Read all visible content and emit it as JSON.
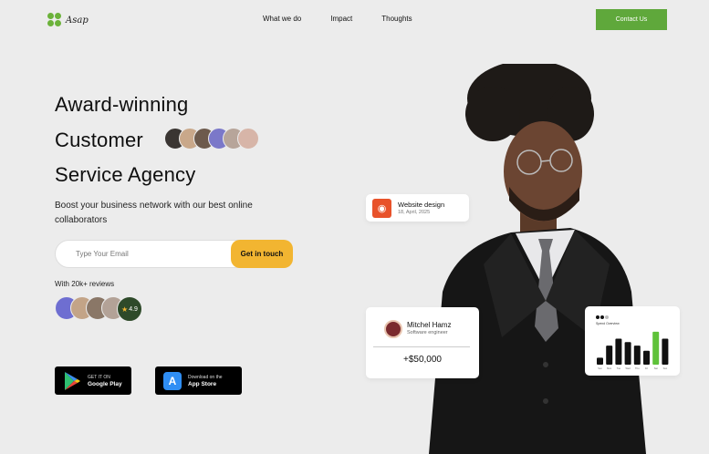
{
  "header": {
    "logo_text": "Asap",
    "nav": [
      "What we do",
      "Impact",
      "Thoughts"
    ],
    "contact_label": "Contact Us"
  },
  "hero": {
    "line1": "Award-winning",
    "line2": "Customer",
    "line3": "Service Agency",
    "subtitle": "Boost your business network with our best online collaborators"
  },
  "email_form": {
    "placeholder": "Type Your Email",
    "button_label": "Get in touch"
  },
  "reviews": {
    "label": "With 20k+ reviews",
    "rating": "4.9"
  },
  "stores": {
    "google": {
      "small": "GET IT ON",
      "big": "Google Play"
    },
    "apple": {
      "small": "Download on the",
      "big": "App Store"
    }
  },
  "cards": {
    "website": {
      "title": "Website design",
      "date": "18, April, 2025"
    },
    "person": {
      "name": "Mitchel Hamz",
      "role": "Software engineer",
      "amount": "+$50,000"
    },
    "chart": {
      "title": "Spend Overview"
    }
  },
  "colors": {
    "accent_green": "#5fa83b",
    "accent_yellow": "#f2b531",
    "background": "#ececec"
  },
  "chart_data": {
    "type": "bar",
    "title": "Spend Overview",
    "categories": [
      "Sun",
      "Mon",
      "Tue",
      "Wed",
      "Thu",
      "Fri",
      "Sat",
      "Sun"
    ],
    "values": [
      20,
      55,
      75,
      65,
      55,
      40,
      95,
      75
    ],
    "highlight_index": 6,
    "ylim": [
      0,
      100
    ]
  }
}
